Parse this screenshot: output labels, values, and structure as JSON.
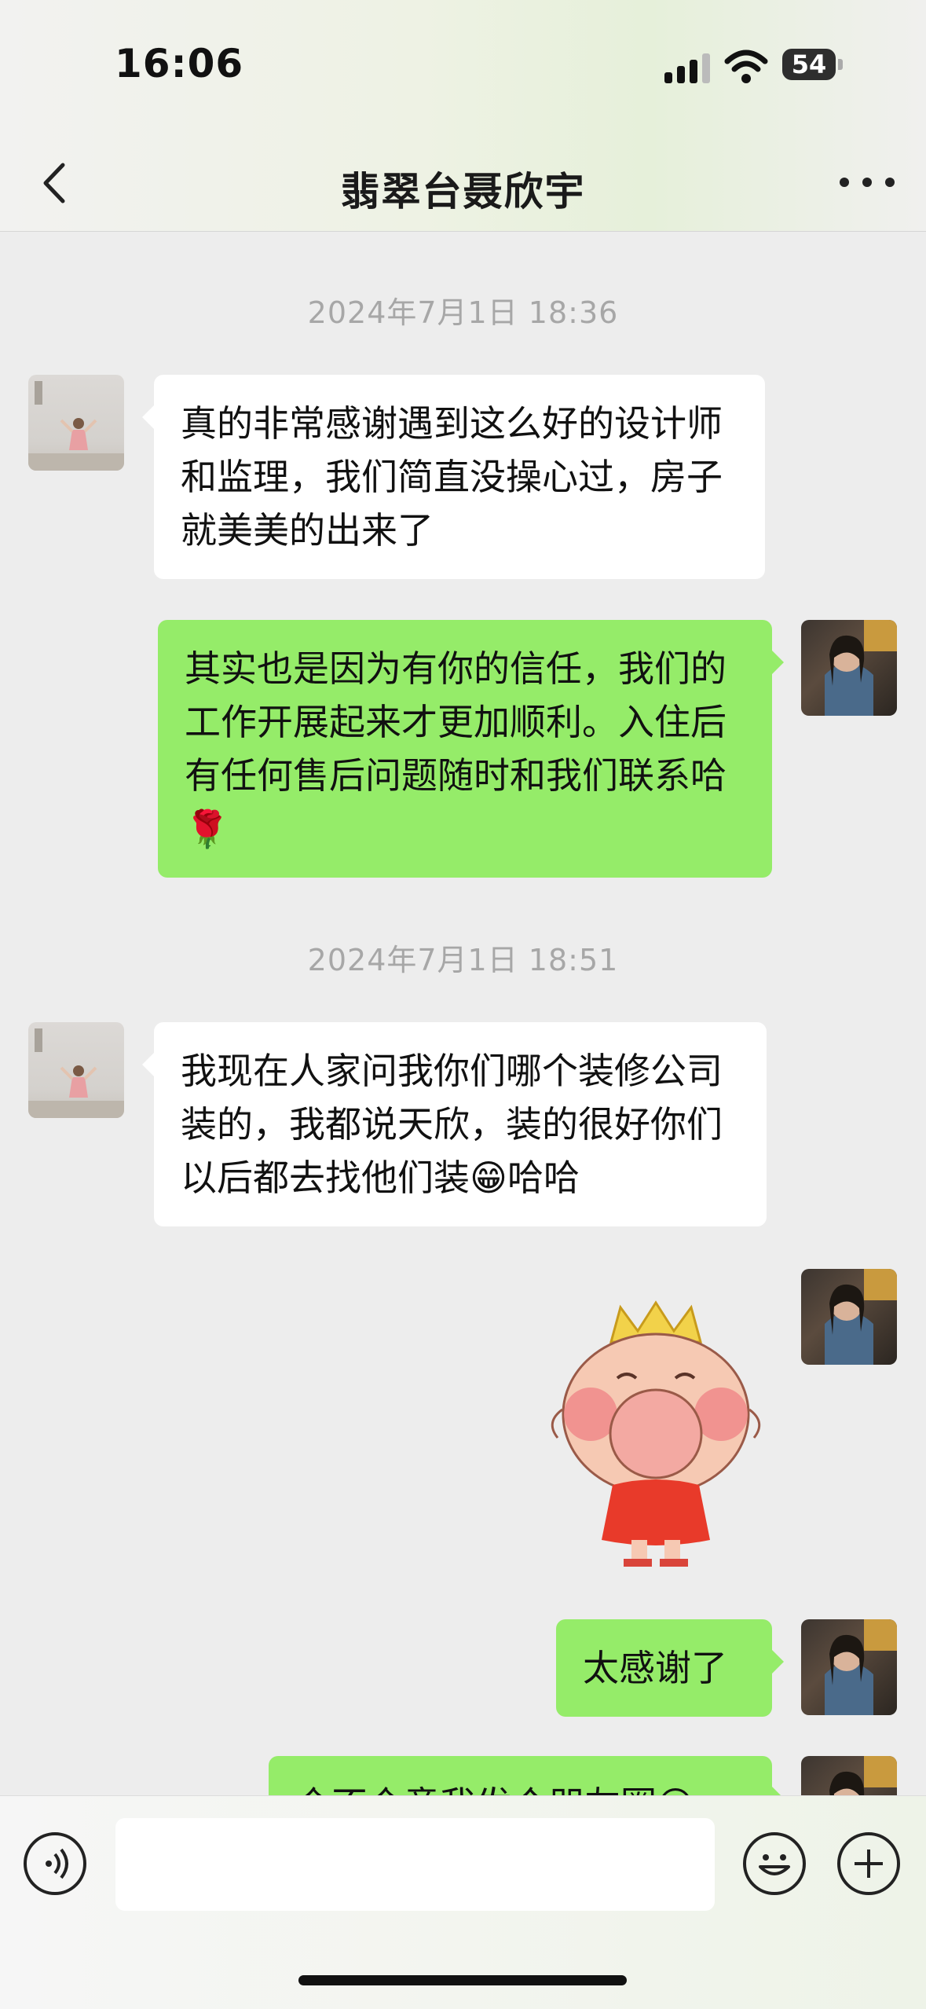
{
  "status_bar": {
    "time": "16:06",
    "battery": "54"
  },
  "header": {
    "title": "翡翠台聂欣宇"
  },
  "messages": {
    "ts1": "2024年7月1日 18:36",
    "m1": "真的非常感谢遇到这么好的设计师和监理，我们简直没操心过，房子就美美的出来了",
    "m2": "其实也是因为有你的信任，我们的工作开展起来才更加顺利。入住后有任何售后问题随时和我们联系哈🌹",
    "ts2": "2024年7月1日 18:51",
    "m3": "我现在人家问我你们哪个装修公司装的，我都说天欣，装的很好你们以后都去找他们装😁哈哈",
    "m4": "太感谢了",
    "m5": "介不介意我发个朋友圈😊"
  },
  "input_bar": {
    "text_value": ""
  },
  "colors": {
    "bubble_self": "#95ec69",
    "bubble_other": "#ffffff",
    "background": "#ededed"
  }
}
